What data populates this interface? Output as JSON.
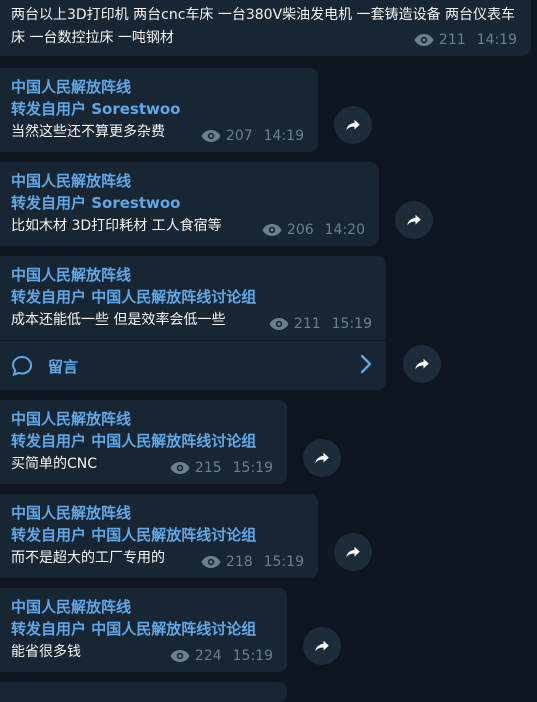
{
  "messages": [
    {
      "text": "两台以上3D打印机 两台cnc车床 一台380V柴油发电机 一套铸造设备 两台仪表车床 一台数控拉床 一吨钢材",
      "views": "211",
      "time": "14:19"
    },
    {
      "author": "中国人民解放阵线",
      "forwarded": "转发自用户 Sorestwoo",
      "text": "当然这些还不算更多杂费",
      "views": "207",
      "time": "14:19"
    },
    {
      "author": "中国人民解放阵线",
      "forwarded": "转发自用户 Sorestwoo",
      "text": "比如木材 3D打印耗材 工人食宿等",
      "views": "206",
      "time": "14:20"
    },
    {
      "author": "中国人民解放阵线",
      "forwarded": "转发自用户 中国人民解放阵线讨论组",
      "text": "成本还能低一些 但是效率会低一些",
      "views": "211",
      "time": "15:19",
      "comments_label": "留言"
    },
    {
      "author": "中国人民解放阵线",
      "forwarded": "转发自用户 中国人民解放阵线讨论组",
      "text": "买简单的CNC",
      "views": "215",
      "time": "15:19"
    },
    {
      "author": "中国人民解放阵线",
      "forwarded": "转发自用户 中国人民解放阵线讨论组",
      "text": "而不是超大的工厂专用的",
      "views": "218",
      "time": "15:19"
    },
    {
      "author": "中国人民解放阵线",
      "forwarded": "转发自用户 中国人民解放阵线讨论组",
      "text": "能省很多钱",
      "views": "224",
      "time": "15:19"
    }
  ],
  "icons": {
    "views": "eye-icon",
    "forward": "share-arrow-icon",
    "comments": "speech-bubble-icon",
    "chevron": "chevron-right-icon"
  },
  "colors": {
    "background": "#0e1621",
    "bubble": "#182533",
    "accent": "#5fa8e8",
    "meta": "#6d7f8f"
  }
}
